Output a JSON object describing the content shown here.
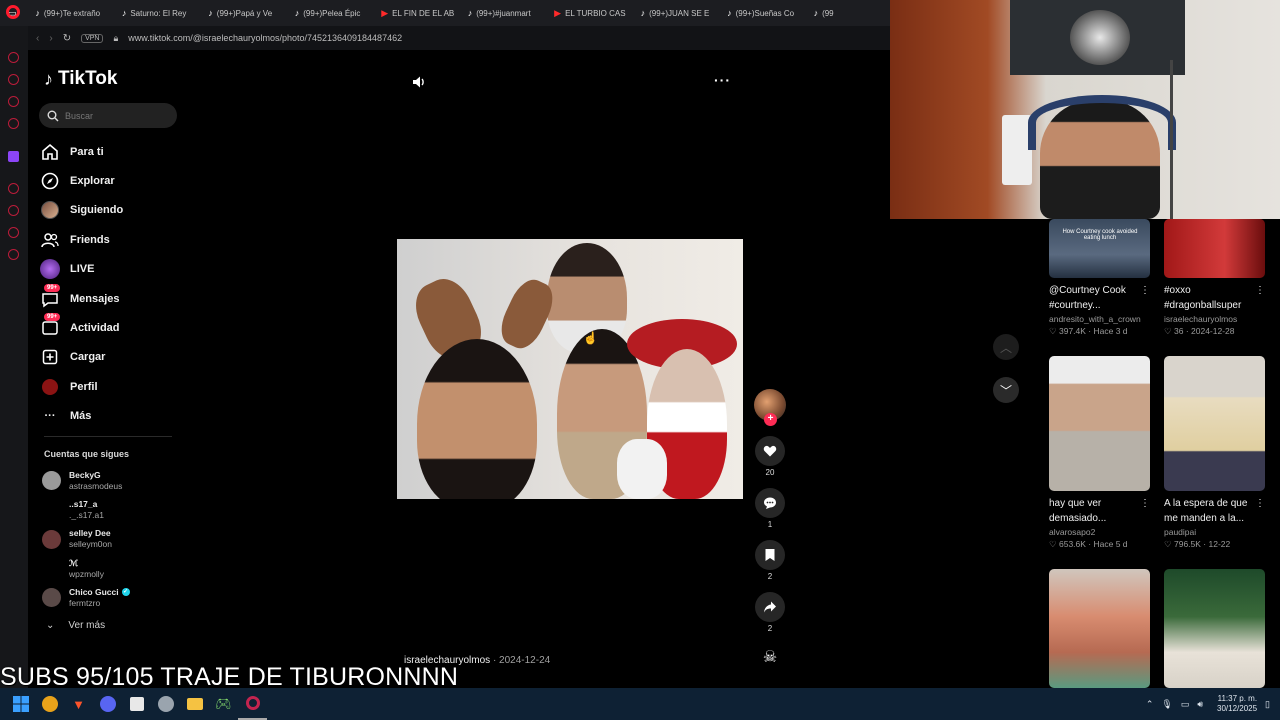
{
  "browser": {
    "tabs": [
      {
        "icon": "tiktok-icon",
        "label": "(99+)Te extraño"
      },
      {
        "icon": "tiktok-icon",
        "label": "Saturno: El Rey"
      },
      {
        "icon": "tiktok-icon",
        "label": "(99+)Papá y Ve"
      },
      {
        "icon": "tiktok-icon",
        "label": "(99+)Pelea Épic"
      },
      {
        "icon": "youtube-icon",
        "label": "EL FIN DE EL AB"
      },
      {
        "icon": "tiktok-icon",
        "label": "(99+)#juanmart"
      },
      {
        "icon": "youtube-icon",
        "label": "EL TURBIO CAS"
      },
      {
        "icon": "tiktok-icon",
        "label": "(99+)JUAN SE E"
      },
      {
        "icon": "tiktok-icon",
        "label": "(99+)Sueñas Co"
      },
      {
        "icon": "tiktok-icon",
        "label": "(99"
      }
    ],
    "vpn_label": "VPN",
    "url": "www.tiktok.com/@israelechauryolmos/photo/7452136409184487462"
  },
  "tiktok": {
    "logo_text": "TikTok",
    "search_placeholder": "Buscar",
    "nav": [
      {
        "label": "Para ti",
        "icon": "home-icon"
      },
      {
        "label": "Explorar",
        "icon": "compass-icon"
      },
      {
        "label": "Siguiendo",
        "icon": "following-avatar-icon"
      },
      {
        "label": "Friends",
        "icon": "friends-icon"
      },
      {
        "label": "LIVE",
        "icon": "live-icon"
      },
      {
        "label": "Mensajes",
        "icon": "messages-icon",
        "badge": "99+"
      },
      {
        "label": "Actividad",
        "icon": "activity-icon",
        "badge": "99+"
      },
      {
        "label": "Cargar",
        "icon": "upload-icon"
      },
      {
        "label": "Perfil",
        "icon": "profile-icon"
      },
      {
        "label": "Más",
        "icon": "more-icon"
      }
    ],
    "following_title": "Cuentas que sigues",
    "following": [
      {
        "name": "BeckyG",
        "handle": "astrasmodeus"
      },
      {
        "name": "..s17_a",
        "handle": "._.s17.a1"
      },
      {
        "name": "selley Dee",
        "handle": "selleym0on"
      },
      {
        "name": "ℳ",
        "handle": "wpzmolly"
      },
      {
        "name": "Chico Gucci",
        "handle": "fermtzro",
        "verified": true
      }
    ],
    "see_more": "Ver más",
    "post": {
      "author": "israelechauryolmos",
      "date": "2024-12-24",
      "likes": "20",
      "comments": "1",
      "saves": "2",
      "shares": "2"
    },
    "recommended": [
      {
        "title": "@Courtney Cook #courtney...",
        "user": "andresito_with_a_crown",
        "views": "397.4K",
        "time": "Hace 3 d",
        "thumb_text": "How Courtney cook avoided eating lunch"
      },
      {
        "title": "#oxxo #dragonballsuper",
        "user": "israelechauryolmos",
        "views": "36",
        "time": "2024-12-28",
        "thumb_text": ""
      },
      {
        "title": "hay que ver demasiado...",
        "user": "alvarosapo2",
        "views": "653.6K",
        "time": "Hace 5 d",
        "thumb_text": ""
      },
      {
        "title": "A la espera de que me manden a la...",
        "user": "paudipai",
        "views": "796.5K",
        "time": "12-22",
        "thumb_text": ""
      }
    ]
  },
  "overlay": {
    "subs_text": "SUBS 95/105 TRAJE DE TIBURONNNN"
  },
  "taskbar": {
    "time": "11:37 p. m.",
    "date": "30/12/2025"
  }
}
